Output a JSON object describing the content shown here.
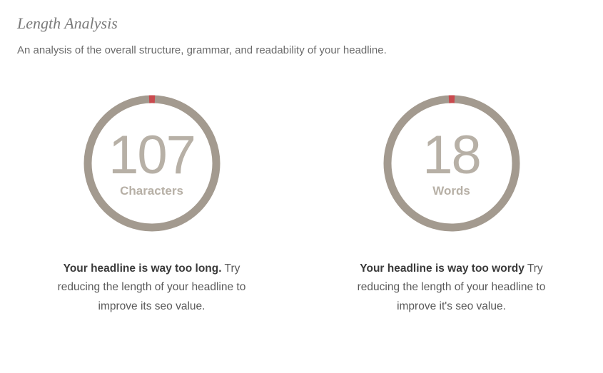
{
  "title": "Length Analysis",
  "description": "An analysis of the overall structure, grammar, and readability of your headline.",
  "metrics": {
    "characters": {
      "value": "107",
      "label": "Characters",
      "strong": "Your headline is way too long.",
      "rest": " Try reducing the length of your headline to improve its seo value."
    },
    "words": {
      "value": "18",
      "label": "Words",
      "strong": "Your headline is way too wordy",
      "rest": " Try reducing the length of your headline to improve it's seo value."
    }
  }
}
